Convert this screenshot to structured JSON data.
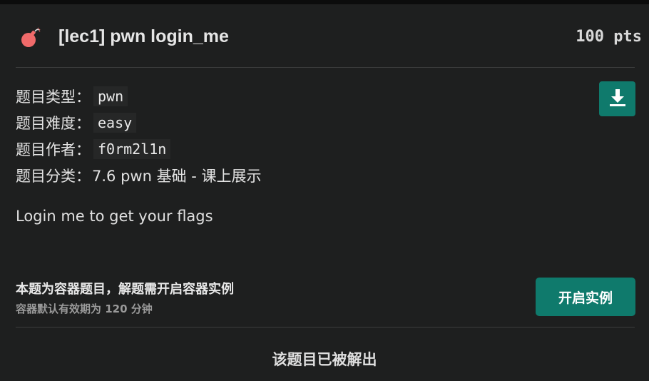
{
  "challenge": {
    "title": "[lec1] pwn login_me",
    "points": "100 pts",
    "icon": "bomb-icon"
  },
  "meta": [
    {
      "label": "题目类型：",
      "value": "pwn",
      "style": "code"
    },
    {
      "label": "题目难度：",
      "value": "easy",
      "style": "code"
    },
    {
      "label": "题目作者：",
      "value": "f0rm2l1n",
      "style": "code"
    },
    {
      "label": "题目分类：",
      "value": "7.6 pwn 基础 - 课上展示",
      "style": "plain"
    }
  ],
  "description": "Login me to get your flags",
  "download_icon": "download-icon",
  "instance": {
    "title": "本题为容器题目，解题需开启容器实例",
    "subtitle": "容器默认有效期为 120 分钟",
    "button_label": "开启实例"
  },
  "status": "该题目已被解出",
  "colors": {
    "accent": "#0f7a6c",
    "background": "#1e1f1f",
    "bomb": "#f06a6a"
  }
}
